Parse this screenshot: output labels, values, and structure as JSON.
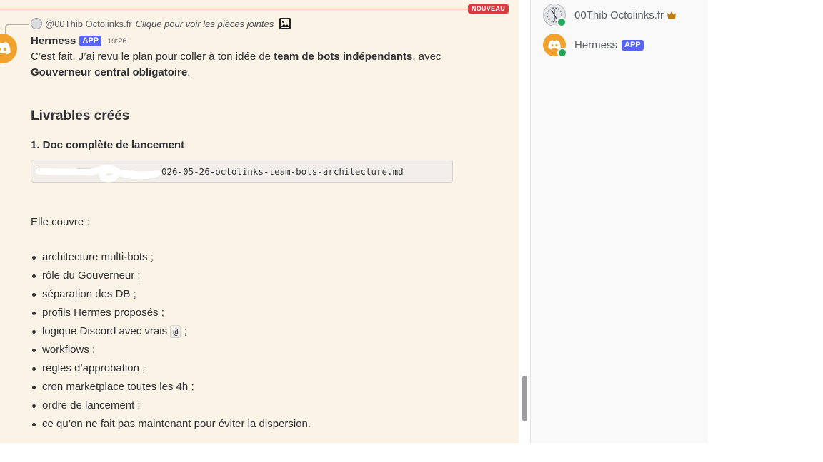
{
  "divider": {
    "badge": "NOUVEAU"
  },
  "reply": {
    "author": "@00Thib Octolinks.fr",
    "hint": "Clique pour voir les pièces jointes"
  },
  "message": {
    "author": "Hermess",
    "app_tag": "APP",
    "time": "19:26",
    "intro_1": "C’est fait. J’ai revu le plan pour coller à ton idée de ",
    "intro_bold_1": "team de bots indépendants",
    "intro_2": ", avec",
    "intro_bold_2": "Gouverneur central obligatoire",
    "intro_3": ".",
    "section_title": "Livrables créés",
    "item_title": "1. Doc complète de lancement",
    "file_path": "026-05-26-octolinks-team-bots-architecture.md",
    "covers_label": "Elle couvre :",
    "bullets": [
      "architecture multi-bots ;",
      "rôle du Gouverneur ;",
      "séparation des DB ;",
      "profils Hermes proposés ;",
      "logique Discord avec vrais",
      "workflows ;",
      "règles d’approbation ;",
      "cron marketplace toutes les 4h ;",
      "ordre de lancement ;",
      "ce qu’on ne fait pas maintenant pour éviter la dispersion."
    ],
    "bullet_4_code": "@",
    "bullet_4_suffix": " ;"
  },
  "members": [
    {
      "name": "00Thib Octolinks.fr",
      "status": "online",
      "icon": "crown-icon"
    },
    {
      "name": "Hermess",
      "tag": "APP",
      "status": "online"
    }
  ],
  "colors": {
    "chat_bg": "#faf3e6",
    "new_red": "#d83c3e",
    "app_blurple": "#5865f2",
    "bot_avatar": "#f0a22c",
    "online": "#23a55a"
  }
}
